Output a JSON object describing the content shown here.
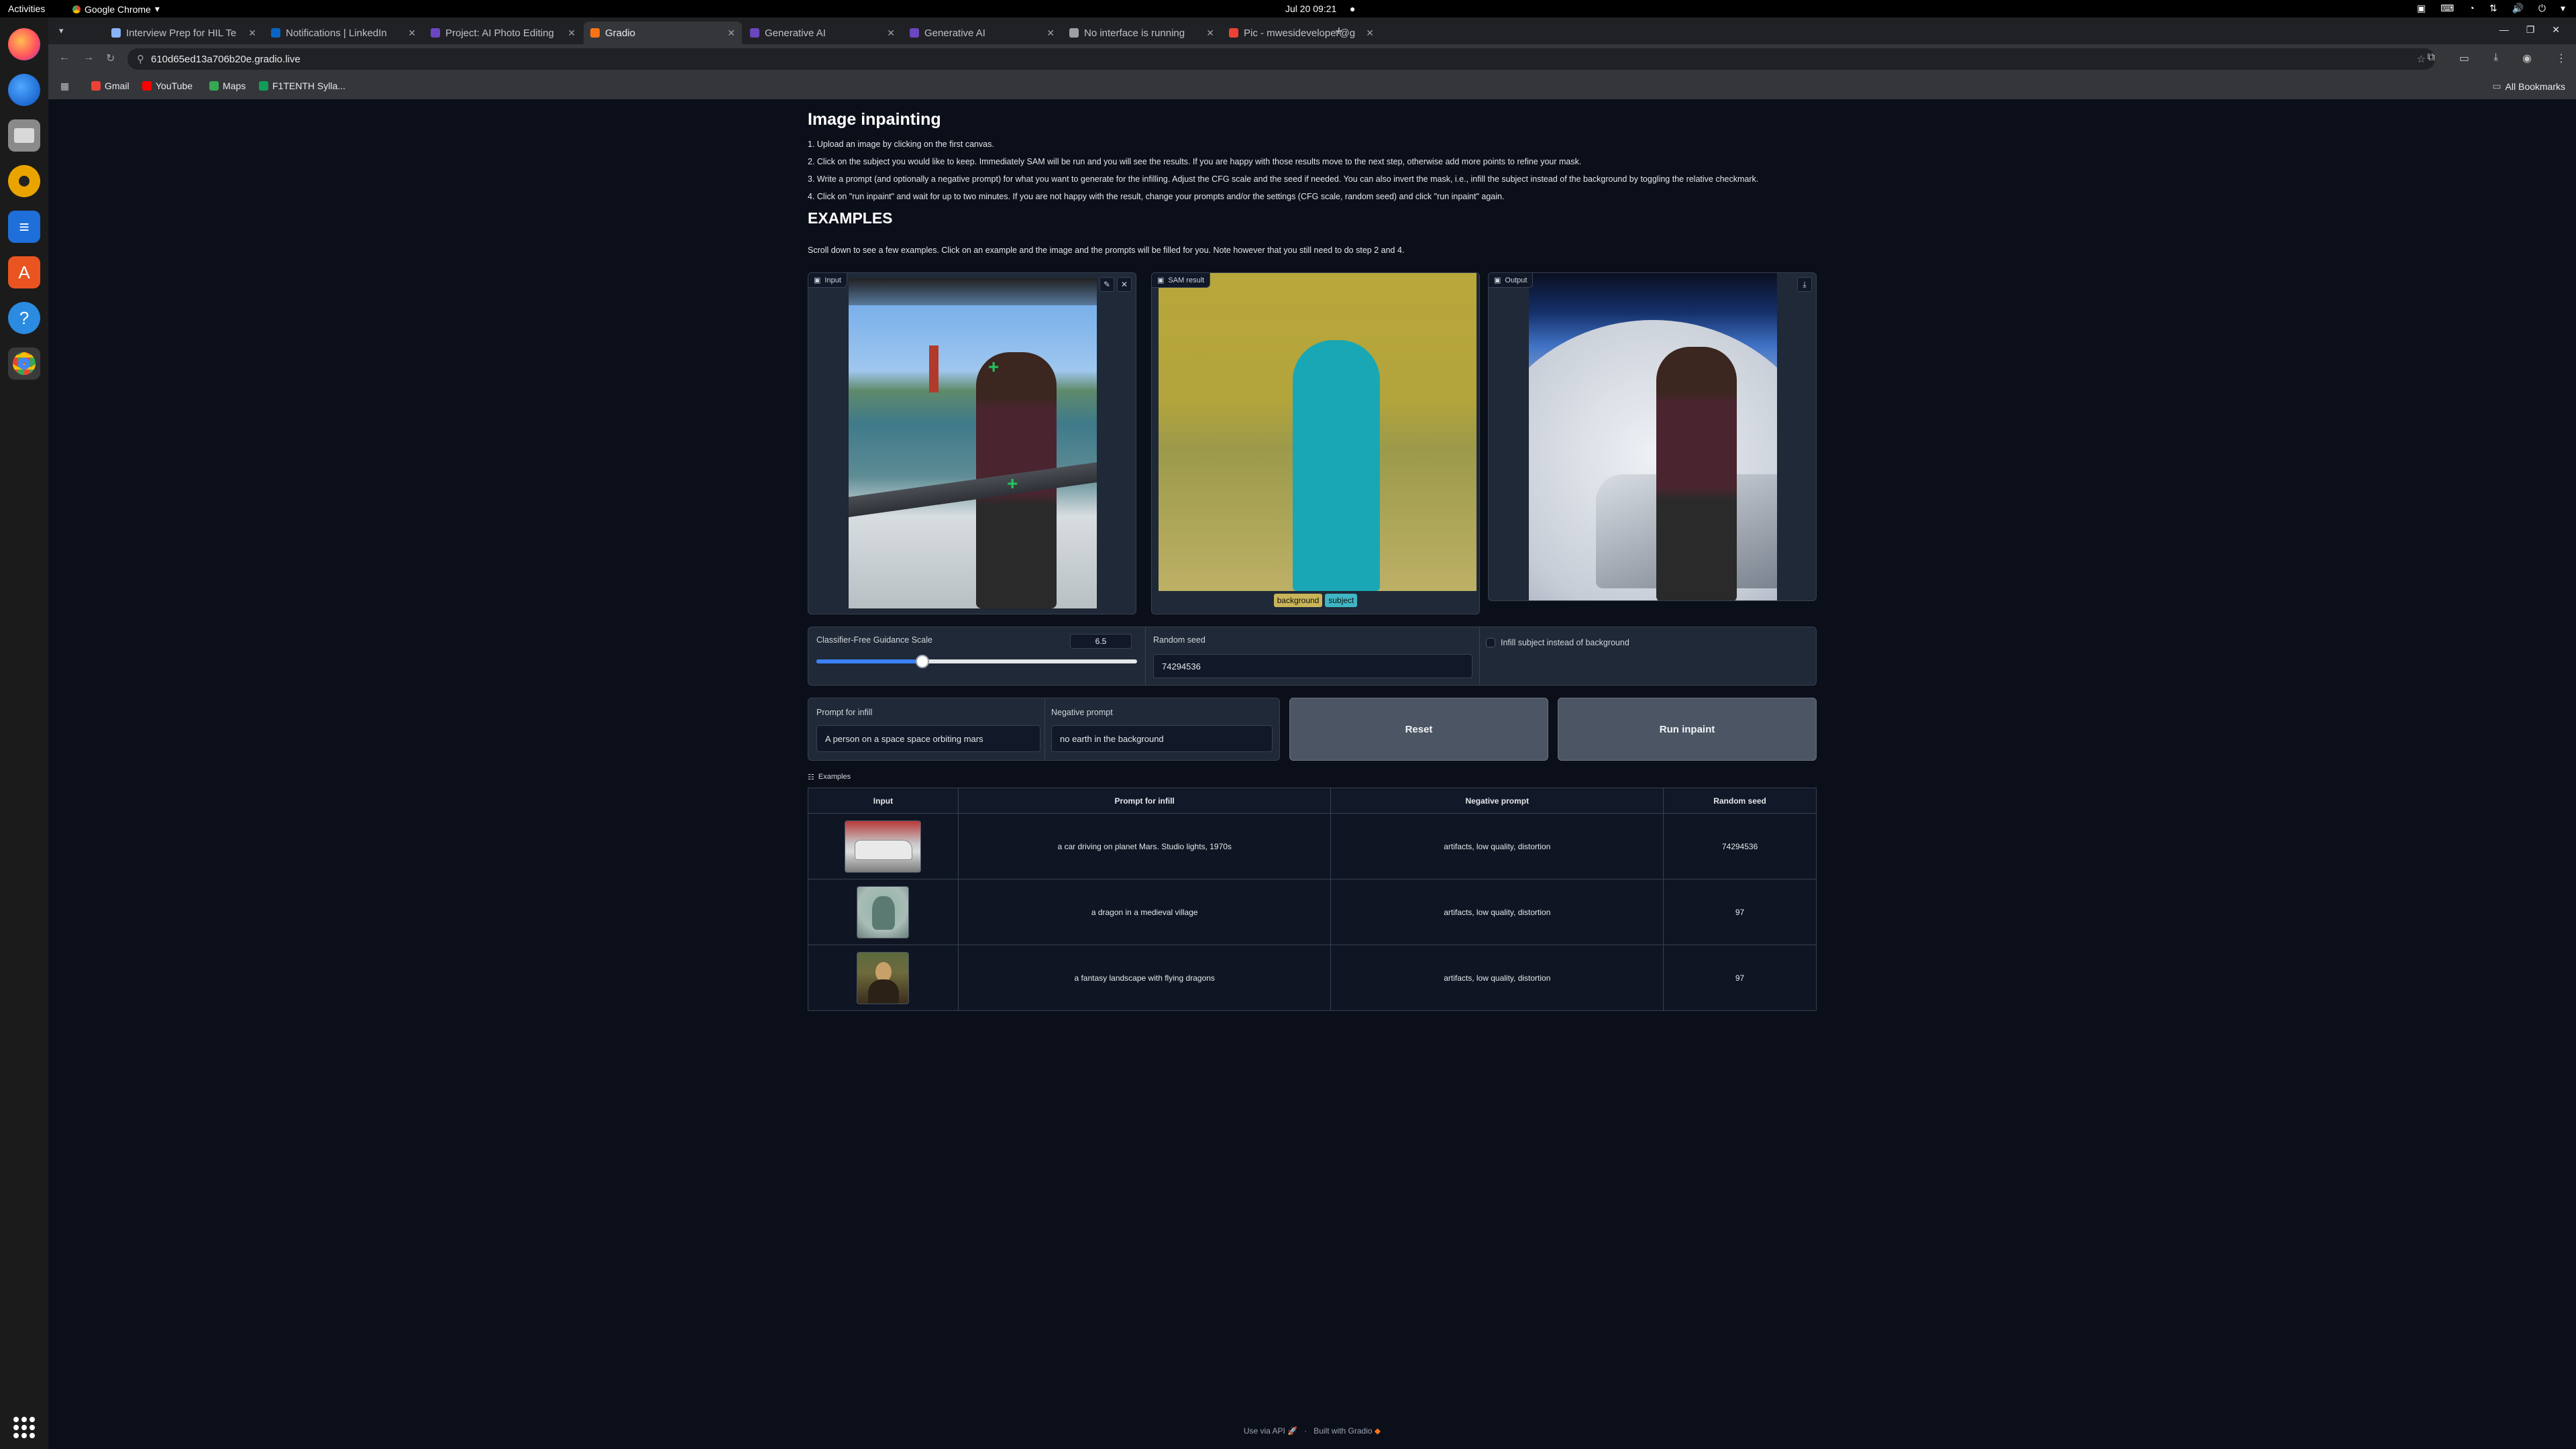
{
  "system": {
    "activities": "Activities",
    "app_name": "Google Chrome",
    "clock": "Jul 20  09:21"
  },
  "browser": {
    "tabs": [
      {
        "title": "Interview Prep for HIL Te",
        "active": false,
        "color": "#8ab4f8"
      },
      {
        "title": "Notifications | LinkedIn",
        "active": false,
        "color": "#0a66c2"
      },
      {
        "title": "Project: AI Photo Editing",
        "active": false,
        "color": "#6b46c1"
      },
      {
        "title": "Gradio",
        "active": true,
        "color": "#f97316"
      },
      {
        "title": "Generative AI",
        "active": false,
        "color": "#6b46c1"
      },
      {
        "title": "Generative AI",
        "active": false,
        "color": "#6b46c1"
      },
      {
        "title": "No interface is running",
        "active": false,
        "color": "#9aa0a6"
      },
      {
        "title": "Pic - mwesideveloper@g",
        "active": false,
        "color": "#ea4335"
      }
    ],
    "url": "610d65ed13a706b20e.gradio.live",
    "bookmarks": [
      {
        "label": "Gmail",
        "color": "#ea4335"
      },
      {
        "label": "YouTube",
        "color": "#ff0000"
      },
      {
        "label": "Maps",
        "color": "#34a853"
      },
      {
        "label": "F1TENTH Sylla...",
        "color": "#0f9d58"
      }
    ],
    "all_bookmarks": "All Bookmarks"
  },
  "page": {
    "title": "Image inpainting",
    "instructions": [
      "1. Upload an image by clicking on the first canvas.",
      "2. Click on the subject you would like to keep. Immediately SAM will be run and you will see the results. If you are happy with those results move to the next step, otherwise add more points to refine your mask.",
      "3. Write a prompt (and optionally a negative prompt) for what you want to generate for the infilling. Adjust the CFG scale and the seed if needed. You can also invert the mask, i.e., infill the subject instead of the background by toggling the relative checkmark.",
      "4. Click on \"run inpaint\" and wait for up to two minutes. If you are not happy with the result, change your prompts and/or the settings (CFG scale, random seed) and click \"run inpaint\" again."
    ],
    "examples_heading": "EXAMPLES",
    "examples_note": "Scroll down to see a few examples. Click on an example and the image and the prompts will be filled for you. Note however that you still need to do step 2 and 4.",
    "panels": {
      "input_label": "Input",
      "sam_label": "SAM result",
      "output_label": "Output",
      "legend_background": "background",
      "legend_subject": "subject",
      "legend_background_color": "#c9b458",
      "legend_subject_color": "#3fb6c4"
    },
    "controls": {
      "cfg_label": "Classifier-Free Guidance Scale",
      "cfg_value": "6.5",
      "cfg_fraction": 0.33,
      "seed_label": "Random seed",
      "seed_value": "74294536",
      "invert_label": "Infill subject instead of background",
      "prompt_label": "Prompt for infill",
      "prompt_value": "A person on a space space orbiting mars",
      "negative_label": "Negative prompt",
      "negative_value": "no earth in the background",
      "reset_label": "Reset",
      "run_label": "Run inpaint"
    },
    "examples": {
      "label": "Examples",
      "headers": [
        "Input",
        "Prompt for infill",
        "Negative prompt",
        "Random seed"
      ],
      "rows": [
        {
          "prompt": "a car driving on planet Mars. Studio lights, 1970s",
          "negative": "artifacts, low quality, distortion",
          "seed": "74294536",
          "thumb": "car"
        },
        {
          "prompt": "a dragon in a medieval village",
          "negative": "artifacts, low quality, distortion",
          "seed": "97",
          "thumb": "dragon"
        },
        {
          "prompt": "a fantasy landscape with flying dragons",
          "negative": "artifacts, low quality, distortion",
          "seed": "97",
          "thumb": "portrait"
        }
      ]
    },
    "footer": {
      "api": "Use via API",
      "built": "Built with Gradio"
    }
  }
}
